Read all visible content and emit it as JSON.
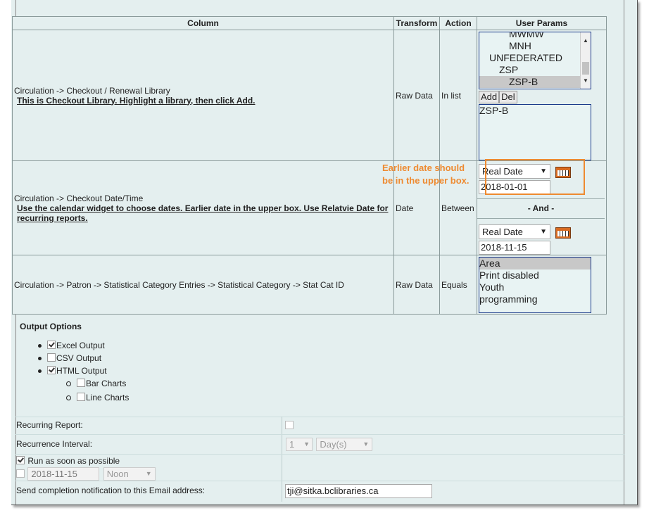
{
  "table": {
    "headers": {
      "column": "Column",
      "transform": "Transform",
      "action": "Action",
      "params": "User Params"
    },
    "rows": [
      {
        "column": "Circulation -> Checkout / Renewal Library",
        "hint": "This is Checkout Library. Highlight a library, then click Add.",
        "transform": "Raw Data",
        "action": "In list",
        "library_list": [
          "MWMW",
          "MNH",
          "UNFEDERATED",
          "ZSP",
          "ZSP-B"
        ],
        "library_selected": "ZSP-B",
        "add_label": "Add",
        "del_label": "Del",
        "chosen": [
          "ZSP-B"
        ]
      },
      {
        "column": "Circulation -> Checkout Date/Time",
        "hint": "Use the calendar widget to choose dates. Earlier date in the upper box. Use Relatvie Date for recurring reports.",
        "transform": "Date",
        "action": "Between",
        "date_type_1": "Real Date",
        "date_1": "2018-01-01",
        "and_label": "- And -",
        "date_type_2": "Real Date",
        "date_2": "2018-11-15"
      },
      {
        "column": "Circulation -> Patron -> Statistical Category Entries -> Statistical Category -> Stat Cat ID",
        "transform": "Raw Data",
        "action": "Equals",
        "stat_options": [
          "Area",
          "Print disabled",
          "Youth",
          "programming"
        ],
        "stat_selected": "Area"
      }
    ]
  },
  "annotation": {
    "line1": "Earlier date should",
    "line2": "be in the upper box.",
    "color": "#ee8a30"
  },
  "output": {
    "title": "Output Options",
    "excel": "Excel Output",
    "csv": "CSV Output",
    "html": "HTML Output",
    "bar": "Bar Charts",
    "line": "Line Charts"
  },
  "schedule": {
    "recurring_label": "Recurring Report:",
    "interval_label": "Recurrence Interval:",
    "interval_value": "1",
    "interval_unit": "Day(s)",
    "run_asap_label": "Run as soon as possible",
    "run_date": "2018-11-15",
    "run_time": "Noon",
    "email_label": "Send completion notification to this Email address:",
    "email_value": "tji@sitka.bclibraries.ca"
  }
}
